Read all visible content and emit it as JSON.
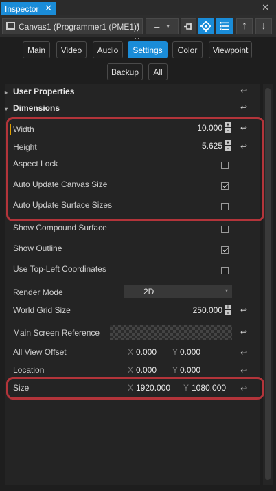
{
  "tab": {
    "title": "Inspector",
    "close": "✕"
  },
  "window_close": "✕",
  "toolbar": {
    "canvas_label": "Canvas1 (Programmer1 (PME1))",
    "chevron": "▾",
    "minus": "–",
    "handle": "····",
    "icons": [
      "pin-icon",
      "target-icon",
      "list-icon",
      "arrow-up-icon",
      "arrow-down-icon"
    ]
  },
  "categories": {
    "main": "Main",
    "video": "Video",
    "audio": "Audio",
    "settings": "Settings",
    "color": "Color",
    "viewpoint": "Viewpoint",
    "backup": "Backup",
    "all": "All"
  },
  "sections": {
    "user_properties": "User Properties",
    "dimensions": "Dimensions"
  },
  "props": {
    "width": {
      "label": "Width",
      "value": "10.000"
    },
    "height": {
      "label": "Height",
      "value": "5.625"
    },
    "aspect_lock": {
      "label": "Aspect Lock",
      "checked": false
    },
    "auto_update_canvas": {
      "label": "Auto Update Canvas Size",
      "checked": true
    },
    "auto_update_surface": {
      "label": "Auto Update Surface Sizes",
      "checked": false
    },
    "show_compound": {
      "label": "Show Compound Surface",
      "checked": false
    },
    "show_outline": {
      "label": "Show Outline",
      "checked": true
    },
    "top_left": {
      "label": "Use Top-Left Coordinates",
      "checked": false
    },
    "render_mode": {
      "label": "Render Mode",
      "value": "2D"
    },
    "world_grid": {
      "label": "World Grid Size",
      "value": "250.000"
    },
    "main_screen_ref": {
      "label": "Main Screen Reference"
    },
    "all_view_offset": {
      "label": "All View Offset",
      "x_axis": "X",
      "x": "0.000",
      "y_axis": "Y",
      "y": "0.000"
    },
    "location": {
      "label": "Location",
      "x_axis": "X",
      "x": "0.000",
      "y_axis": "Y",
      "y": "0.000"
    },
    "size": {
      "label": "Size",
      "x_axis": "X",
      "x": "1920.000",
      "y_axis": "Y",
      "y": "1080.000"
    }
  },
  "glyphs": {
    "reset": "↩",
    "plus": "+",
    "minus": "-",
    "arrow_right": "▸",
    "arrow_down": "▾"
  },
  "colors": {
    "accent": "#1a8cd8",
    "highlight": "#b3343a",
    "background": "#1e1e1e"
  }
}
